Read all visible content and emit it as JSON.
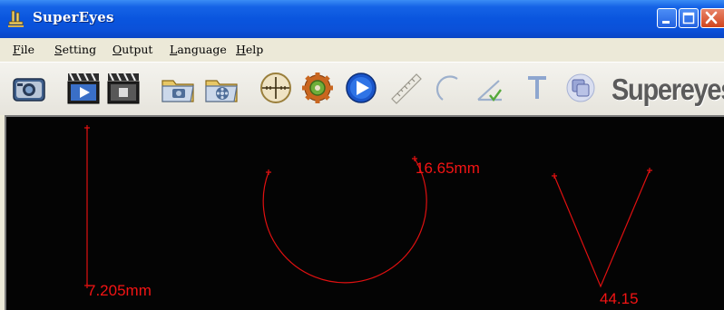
{
  "window": {
    "title": "SuperEyes",
    "title_icon": "microscope-icon",
    "caption_buttons": [
      "minimize-icon",
      "maximize-icon",
      "close-icon"
    ]
  },
  "menu": {
    "items": [
      {
        "label": "File",
        "accel": "F",
        "rest": "ile"
      },
      {
        "label": "Setting",
        "accel": "S",
        "rest": "etting"
      },
      {
        "label": "Output",
        "accel": "O",
        "rest": "utput"
      },
      {
        "label": "Language",
        "accel": "L",
        "rest": "anguage"
      },
      {
        "label": "Help",
        "accel": "H",
        "rest": "elp"
      }
    ]
  },
  "toolbar": {
    "icons": [
      "snapshot-camera-icon",
      "video-record-icon",
      "video-stop-icon",
      "photo-album-icon",
      "video-album-icon",
      "crosshair-icon",
      "settings-gear-icon",
      "play-icon",
      "ruler-measure-icon",
      "arc-measure-icon",
      "angle-measure-icon",
      "text-tool-icon",
      "overlay-icon"
    ],
    "brand": "Supereyes"
  },
  "measurements": {
    "line_length": "7.205mm",
    "circle_diameter": "16.65mm",
    "angle": "44.15",
    "stroke_color": "#e01010",
    "label_color": "#f31414"
  }
}
